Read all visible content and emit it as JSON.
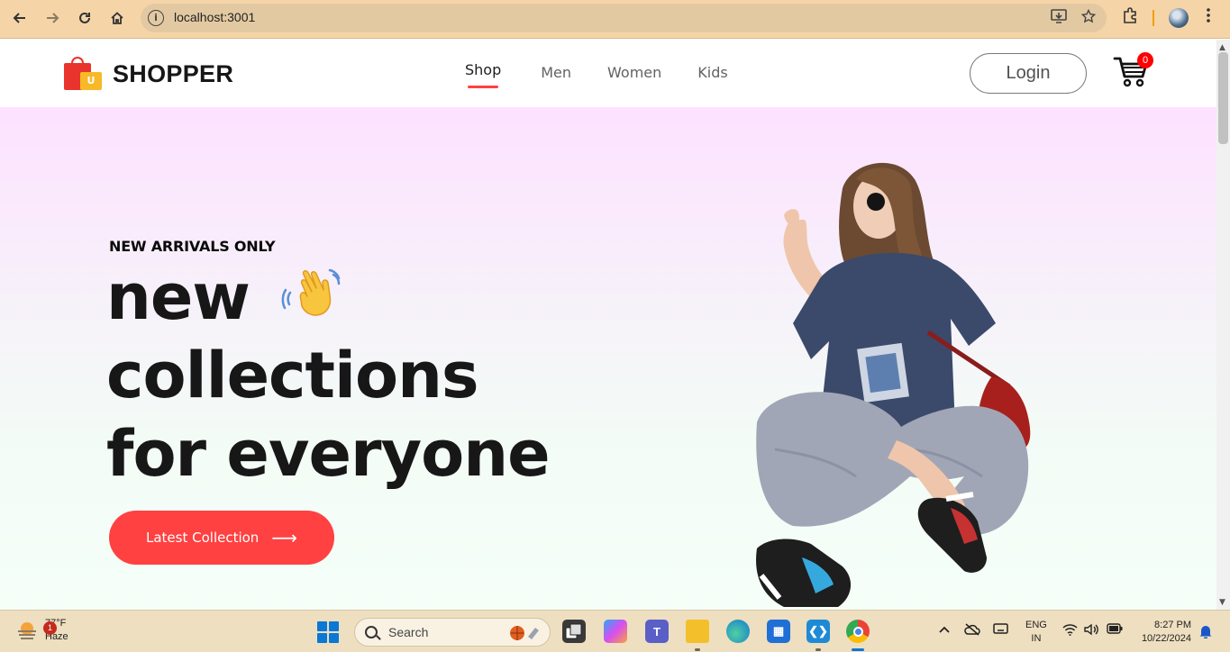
{
  "browser": {
    "url": "localhost:3001",
    "info_symbol": "i"
  },
  "header": {
    "brand": "SHOPPER",
    "logo_letter": "U",
    "menu": [
      "Shop",
      "Men",
      "Women",
      "Kids"
    ],
    "active_menu": "Shop",
    "login_label": "Login",
    "cart_count": "0"
  },
  "hero": {
    "eyebrow": "NEW ARRIVALS ONLY",
    "line1": "new",
    "line2": "collections",
    "line3": "for everyone",
    "cta_label": "Latest Collection",
    "cta_arrow": "⟶"
  },
  "taskbar": {
    "weather_alerts": "1",
    "temperature": "77°F",
    "condition": "Haze",
    "search_placeholder": "Search",
    "language_line1": "ENG",
    "language_line2": "IN",
    "time": "8:27 PM",
    "date": "10/22/2024"
  },
  "colors": {
    "accent": "#ff4141",
    "hero_top": "#fde1ff",
    "hero_bottom": "#f5fff8",
    "browser_chrome": "#f5d4a8",
    "taskbar": "#eedfc0"
  },
  "icons": [
    "back-icon",
    "forward-icon",
    "reload-icon",
    "home-icon",
    "site-info-icon",
    "install-icon",
    "bookmark-star-icon",
    "extensions-icon",
    "profile-avatar-icon",
    "menu-dots-icon",
    "cart-icon",
    "wave-hand-icon",
    "arrow-right-icon",
    "weather-icon",
    "windows-start-icon",
    "search-icon",
    "task-view-icon",
    "copilot-icon",
    "teams-icon",
    "file-explorer-icon",
    "edge-icon",
    "store-icon",
    "vscode-icon",
    "chrome-icon",
    "chevron-up-icon",
    "onedrive-icon",
    "display-icon",
    "wifi-icon",
    "volume-icon",
    "battery-icon",
    "notification-bell-icon"
  ]
}
